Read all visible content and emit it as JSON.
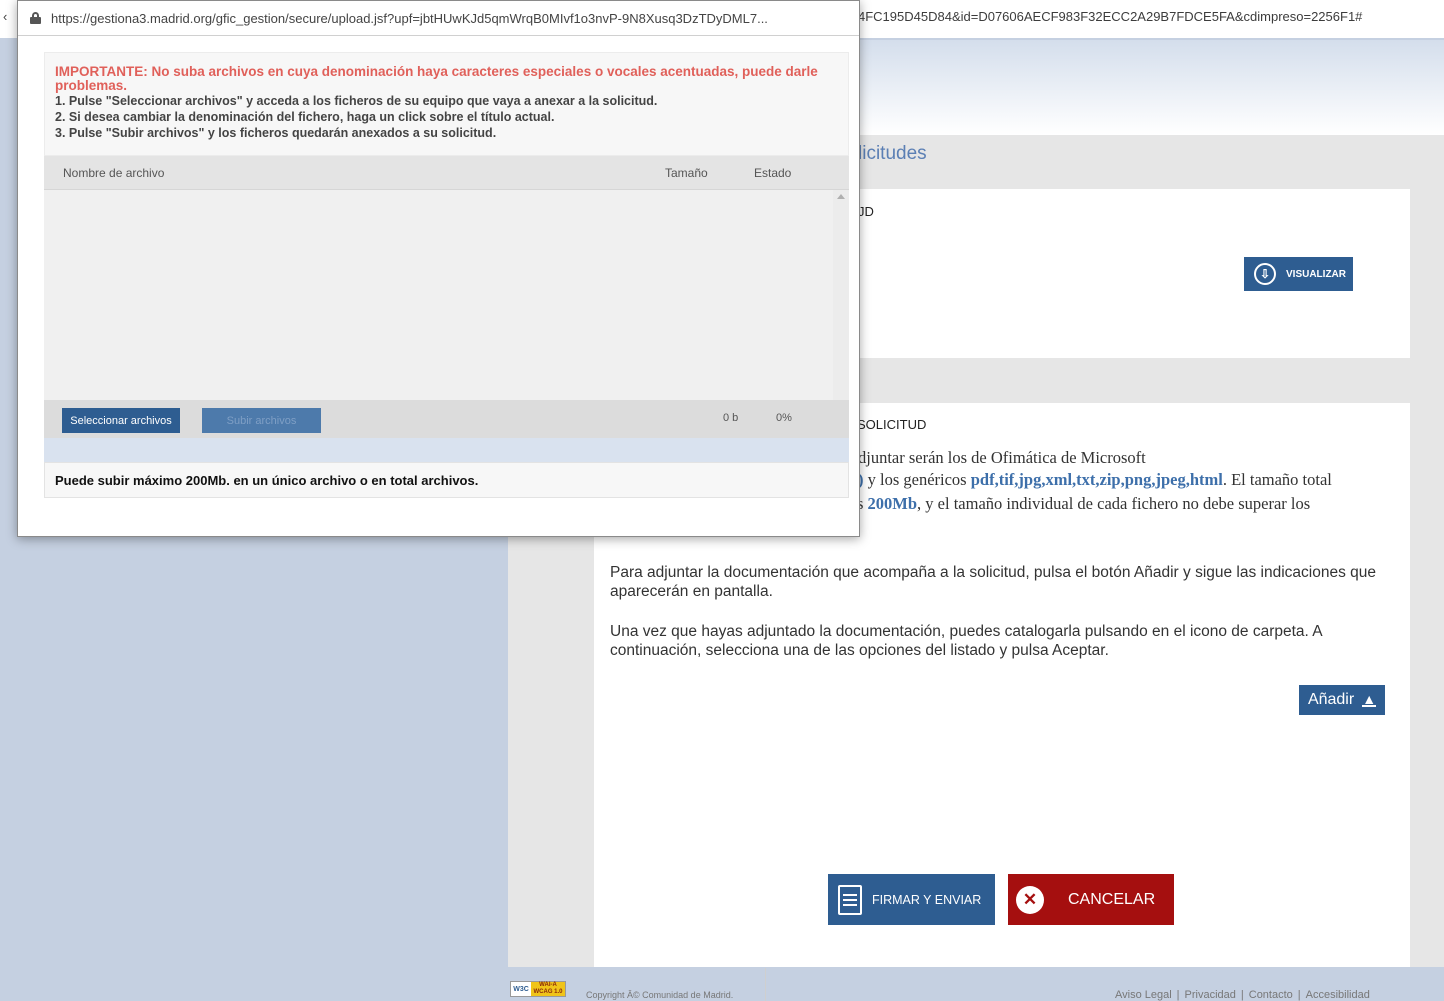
{
  "background": {
    "url_tail": "4FC195D45D84&id=D07606AECF983F32ECC2A29B7FDCE5FA&cdimpreso=2256F1#",
    "section_title": "licitudes",
    "card1_label": "JD",
    "visualizar_label": "VISUALIZAR",
    "card2_title": "SOLICITUD",
    "formats_line1": "djuntar serán los de Ofimática de Microsoft",
    "formats_line2_paren": ")",
    "formats_line2_text": " y los genéricos ",
    "formats_generic": "pdf,tif,jpg,xml,txt,zip,png,jpeg,html",
    "formats_line2_end": ". El tamaño total",
    "size_line3_prefix": "s ",
    "size_total": "200Mb",
    "size_line3_text": ", y el tamaño individual de cada fichero no debe superar los",
    "para_adjuntar": "Para adjuntar la documentación que acompaña a la solicitud, pulsa el botón Añadir y sigue las indicaciones que aparecerán en pantalla.",
    "para_catalogar": "Una vez que hayas adjuntado la documentación, puedes catalogarla pulsando en el icono de carpeta. A continuación, selecciona una de las opciones del listado y pulsa Aceptar.",
    "anadir_label": "Añadir",
    "firmar_label": "FIRMAR Y ENVIAR",
    "cancelar_label": "CANCELAR",
    "wcag_w3c": "W3C",
    "wcag_badge": "WAI-A WCAG 1.0",
    "copyright": "Copyright Â© Comunidad de Madrid.",
    "footer_links": [
      "Aviso Legal",
      "Privacidad",
      "Contacto",
      "Accesibilidad"
    ]
  },
  "popup": {
    "url": "https://gestiona3.madrid.org/gfic_gestion/secure/upload.jsf?upf=jbtHUwKJd5qmWrqB0MIvf1o3nvP-9N8Xusq3DzTDyDML7...",
    "warning": "IMPORTANTE: No suba archivos en cuya denominación haya caracteres especiales o vocales acentuadas, puede darle problemas.",
    "steps": [
      "1. Pulse \"Seleccionar archivos\" y acceda a los ficheros de su equipo que vaya a anexar a la solicitud.",
      "2. Si desea cambiar la denominación del fichero, haga un click sobre el título actual.",
      "3. Pulse \"Subir archivos\" y los ficheros quedarán anexados a su solicitud."
    ],
    "columns": {
      "name": "Nombre de archivo",
      "size": "Tamaño",
      "status": "Estado"
    },
    "select_label": "Seleccionar archivos",
    "upload_label": "Subir archivos",
    "total_size": "0 b",
    "progress": "0%",
    "limit_note": "Puede subir máximo 200Mb. en un único archivo o en total archivos."
  },
  "colors": {
    "primary": "#2e5d91",
    "danger": "#a50f0f",
    "warning": "#e0605a",
    "link": "#3d6faa"
  }
}
